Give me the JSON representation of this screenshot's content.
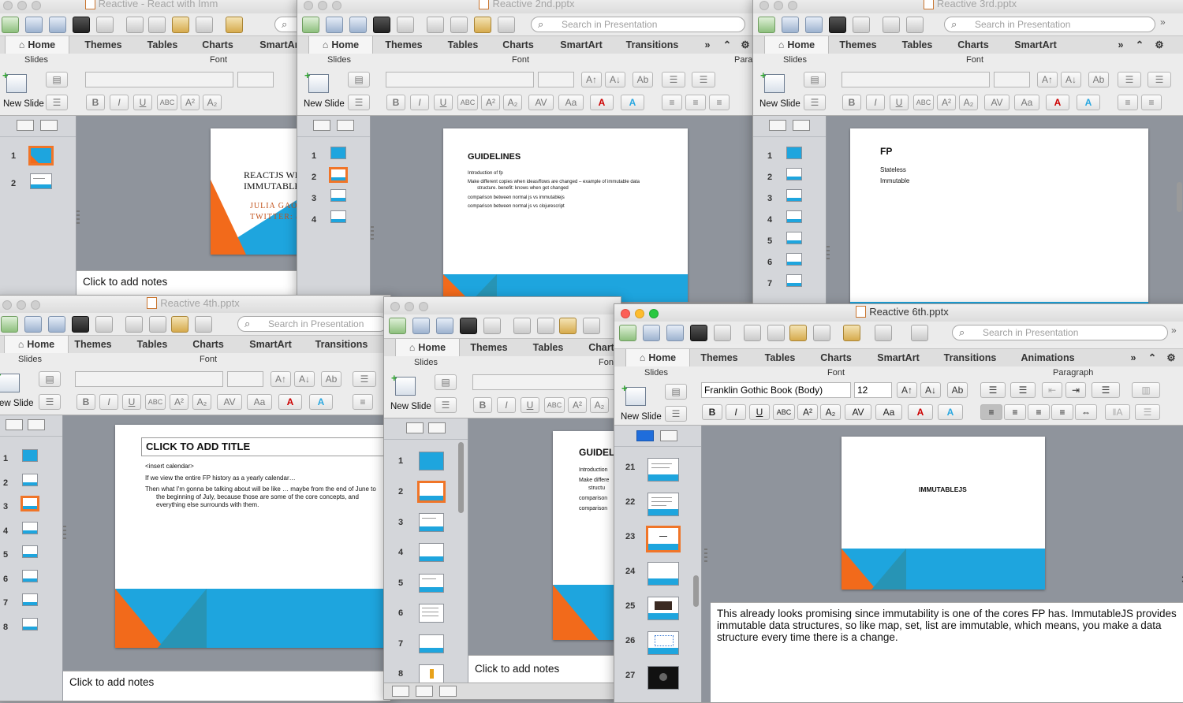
{
  "common": {
    "tabs": [
      "Home",
      "Themes",
      "Tables",
      "Charts",
      "SmartArt",
      "Transitions",
      "Animations"
    ],
    "groups": {
      "slides": "Slides",
      "font": "Font",
      "paragraph": "Paragraph",
      "para_short": "Para"
    },
    "new_slide": "New Slide",
    "notes_placeholder": "Click to add notes",
    "search_placeholder": "Search in Presentation",
    "font_name": "Franklin Gothic Book (Body)",
    "font_size": "12"
  },
  "win1": {
    "title": "Reactive - React with Imm",
    "thumbs": [
      "1",
      "2"
    ],
    "slide": {
      "title_line1": "REACTJS WI",
      "title_line2": "IMMUTABLE",
      "sub_line1": "JULIA GAO",
      "sub_line2": "TWITTER: @"
    }
  },
  "win2": {
    "title": "Reactive 2nd.pptx",
    "thumbs": [
      "1",
      "2",
      "3",
      "4"
    ],
    "slide": {
      "title": "GUIDELINES",
      "lines": [
        "Introduction of fp",
        "Make different copies when ideas/flows are changed – example of immutable data",
        "structure. benefit: knows when got changed",
        "comparison between normal js vs immutablejs",
        "comparison between normal js vs clojurescript"
      ]
    }
  },
  "win3": {
    "title": "Reactive 3rd.pptx",
    "thumbs": [
      "1",
      "2",
      "3",
      "4",
      "5",
      "6",
      "7"
    ],
    "slide": {
      "title": "FP",
      "lines": [
        "Stateless",
        "Immutable"
      ]
    }
  },
  "win4": {
    "title": "Reactive 4th.pptx",
    "thumbs": [
      "1",
      "2",
      "3",
      "4",
      "5",
      "6",
      "7",
      "8"
    ],
    "slide": {
      "title": "CLICK TO ADD TITLE",
      "lines": [
        "<insert calendar>",
        "If we view the entire FP history as a yearly calendar…",
        "Then what I'm gonna be talking about will be like … maybe from the end of June to",
        "the beginning of July, because those are some of the core concepts, and",
        "everything else surrounds with them."
      ]
    }
  },
  "win5": {
    "title": "",
    "thumbs": [
      "1",
      "2",
      "3",
      "4",
      "5",
      "6",
      "7",
      "8"
    ],
    "slide": {
      "title": "GUIDEL",
      "lines": [
        "Introduction",
        "Make differe",
        "structu",
        "comparison",
        "comparison"
      ]
    }
  },
  "win6": {
    "title": "Reactive 6th.pptx",
    "thumbs": [
      "21",
      "22",
      "23",
      "24",
      "25",
      "26",
      "27"
    ],
    "slide": {
      "title": "IMMUTABLEJS"
    },
    "notes": "This already looks promising since immutability is one of the cores FP has. ImmutableJS provides immutable data structures, so like map, set, list are immutable, which means, you make a data structure every time there is a change."
  },
  "colors": {
    "orange": "#f26a1b",
    "blue": "#1ea5de",
    "teal": "#2794b5",
    "selection": "#f07528"
  }
}
